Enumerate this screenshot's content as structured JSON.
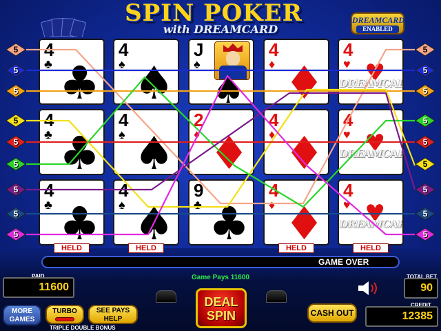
{
  "title": {
    "main": "SPIN POKER",
    "sub": "with DREAMCARD"
  },
  "badge": {
    "line1": "DREAMCARD",
    "line2": "ENABLED"
  },
  "rows": [
    [
      {
        "rank": "4",
        "suit": "♣",
        "color": "blk"
      },
      {
        "rank": "4",
        "suit": "♠",
        "color": "blk"
      },
      {
        "rank": "J",
        "suit": "♠",
        "color": "blk",
        "face": true
      },
      {
        "rank": "4",
        "suit": "♦",
        "color": "red"
      },
      {
        "rank": "4",
        "suit": "♥",
        "color": "red",
        "dream": true
      }
    ],
    [
      {
        "rank": "4",
        "suit": "♣",
        "color": "blk"
      },
      {
        "rank": "4",
        "suit": "♠",
        "color": "blk"
      },
      {
        "rank": "2",
        "suit": "♦",
        "color": "red"
      },
      {
        "rank": "4",
        "suit": "♦",
        "color": "red"
      },
      {
        "rank": "4",
        "suit": "♥",
        "color": "red",
        "dream": true
      }
    ],
    [
      {
        "rank": "4",
        "suit": "♣",
        "color": "blk"
      },
      {
        "rank": "4",
        "suit": "♠",
        "color": "blk"
      },
      {
        "rank": "9",
        "suit": "♣",
        "color": "blk"
      },
      {
        "rank": "4",
        "suit": "♦",
        "color": "red"
      },
      {
        "rank": "4",
        "suit": "♥",
        "color": "red",
        "dream": true
      }
    ]
  ],
  "dream_card_text": "DREAMCARD",
  "held_labels": [
    "HELD",
    "HELD",
    "",
    "HELD",
    "HELD"
  ],
  "left_diamonds": [
    {
      "value": "5",
      "color": "#f4a58a"
    },
    {
      "value": "5",
      "color": "#1c2bd0"
    },
    {
      "value": "5",
      "color": "#f2a21a"
    },
    {
      "value": "5",
      "color": "#f3e01a"
    },
    {
      "value": "5",
      "color": "#e02020"
    },
    {
      "value": "5",
      "color": "#2ad62a"
    },
    {
      "value": "5",
      "color": "#7a1a8a"
    },
    {
      "value": "5",
      "color": "#1a4a8a"
    },
    {
      "value": "5",
      "color": "#e02ae0"
    }
  ],
  "right_diamonds": [
    {
      "value": "5",
      "color": "#f4a58a"
    },
    {
      "value": "5",
      "color": "#1c2bd0"
    },
    {
      "value": "5",
      "color": "#f2a21a"
    },
    {
      "value": "5",
      "color": "#2ad62a"
    },
    {
      "value": "5",
      "color": "#e02020"
    },
    {
      "value": "5",
      "color": "#f3e01a"
    },
    {
      "value": "5",
      "color": "#7a1a8a"
    },
    {
      "value": "5",
      "color": "#1a4a8a"
    },
    {
      "value": "5",
      "color": "#e02ae0"
    }
  ],
  "message": "GAME OVER",
  "game_pays": "Game Pays 11600",
  "paid": {
    "label": "PAID",
    "value": "11600"
  },
  "total_bet": {
    "label": "TOTAL BET",
    "value": "90"
  },
  "credit": {
    "label": "CREDIT",
    "value": "12385"
  },
  "buttons": {
    "more_games": "MORE GAMES",
    "turbo": "TURBO",
    "see_pays": "SEE PAYS HELP",
    "deal_spin": "DEAL SPIN",
    "cash_out": "CASH OUT"
  },
  "footer": "TRIPLE DOUBLE BONUS"
}
